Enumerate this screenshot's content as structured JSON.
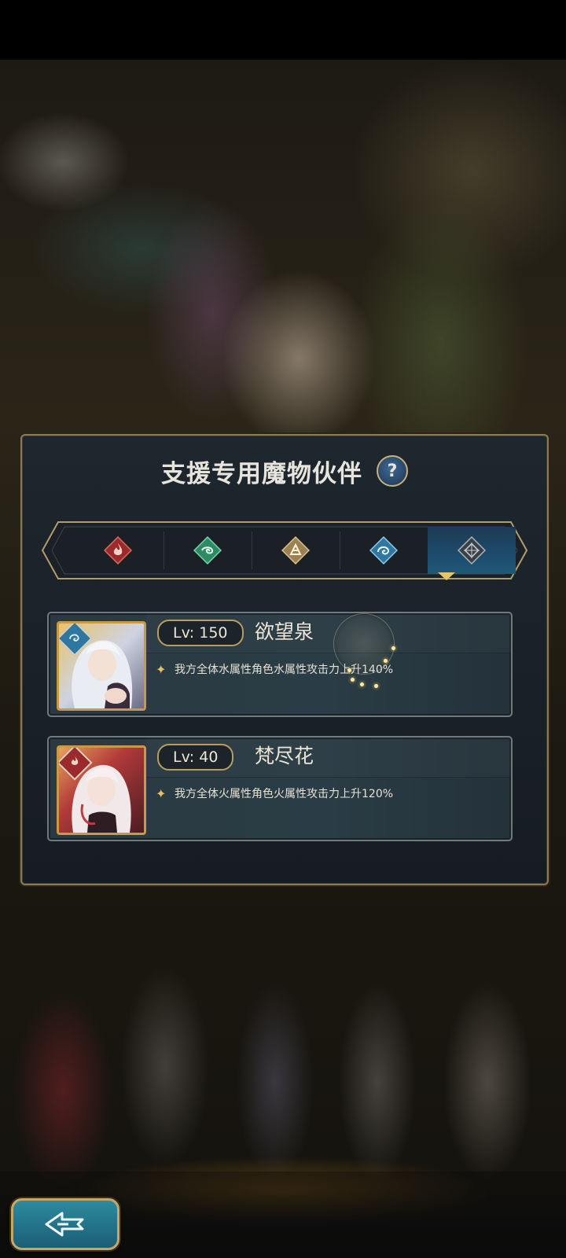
{
  "panel": {
    "title": "支援专用魔物伙伴",
    "help_label": "?"
  },
  "tabs": [
    {
      "element": "fire",
      "icon": "fire-element-icon",
      "color": "#b8333a",
      "selected": false
    },
    {
      "element": "wind",
      "icon": "wind-element-icon",
      "color": "#3aa377",
      "selected": false
    },
    {
      "element": "earth",
      "icon": "earth-element-icon",
      "color": "#b89a6a",
      "selected": false
    },
    {
      "element": "water",
      "icon": "water-element-icon",
      "color": "#3f8fb8",
      "selected": false
    },
    {
      "element": "void",
      "icon": "void-element-icon",
      "color": "#6a7078",
      "selected": true
    }
  ],
  "partners": [
    {
      "level": "Lv: 150",
      "name": "欲望泉",
      "element": "water",
      "effect": "我方全体水属性角色水属性攻击力上升140%"
    },
    {
      "level": "Lv: 40",
      "name": "梵尽花",
      "element": "fire",
      "effect": "我方全体火属性角色火属性攻击力上升120%"
    }
  ],
  "colors": {
    "accent_gold": "#c7a86a",
    "panel_bg": "#1b2229",
    "selected_tab": "#20587a"
  },
  "back_button": {
    "icon": "back-arrow-icon"
  }
}
